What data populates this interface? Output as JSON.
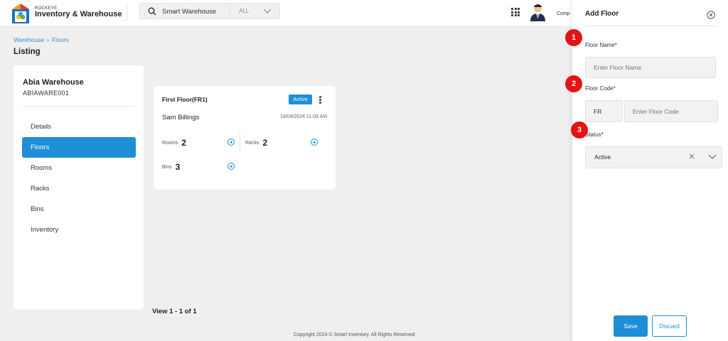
{
  "header": {
    "brand_small": "ROCKEYE",
    "brand_main": "Inventory & Warehouse",
    "search_value": "Smart Warehouse",
    "search_filter": "ALL",
    "company_label": "Comp"
  },
  "breadcrumb": {
    "item1": "Warehouse",
    "separator": "»",
    "item2": "Floors"
  },
  "page_title": "Listing",
  "warehouse": {
    "name": "Abia Warehouse",
    "code": "ABIAWARE001"
  },
  "sidebar": {
    "items": [
      {
        "label": "Details"
      },
      {
        "label": "Floors",
        "active": true
      },
      {
        "label": "Rooms"
      },
      {
        "label": "Racks"
      },
      {
        "label": "Bins"
      },
      {
        "label": "Inventory"
      }
    ]
  },
  "floor_card": {
    "title": "First Floor(FR1)",
    "status": "Active",
    "person": "Sam Billings",
    "date": "18/04/2024 11:08 AM",
    "rooms_label": "Rooms",
    "rooms_value": "2",
    "racks_label": "Racks",
    "racks_value": "2",
    "bins_label": "Bins",
    "bins_value": "3"
  },
  "view_count": "View 1 - 1 of 1",
  "copyright": "Copyright 2024 © Smart Inventory. All Rights Reserved",
  "drawer": {
    "title": "Add Floor",
    "floor_name_label": "Floor Name",
    "floor_name_placeholder": "Enter Floor Name",
    "floor_code_label": "Floor Code",
    "floor_code_prefix": "FR",
    "floor_code_placeholder": "Enter Floor Code",
    "status_label": "Status",
    "status_value": "Active",
    "required_mark": "*",
    "save_label": "Save",
    "discard_label": "Discard"
  },
  "markers": [
    "1",
    "2",
    "3"
  ],
  "colors": {
    "accent": "#1e8fd6",
    "marker": "#e41414",
    "background": "#efefef"
  }
}
